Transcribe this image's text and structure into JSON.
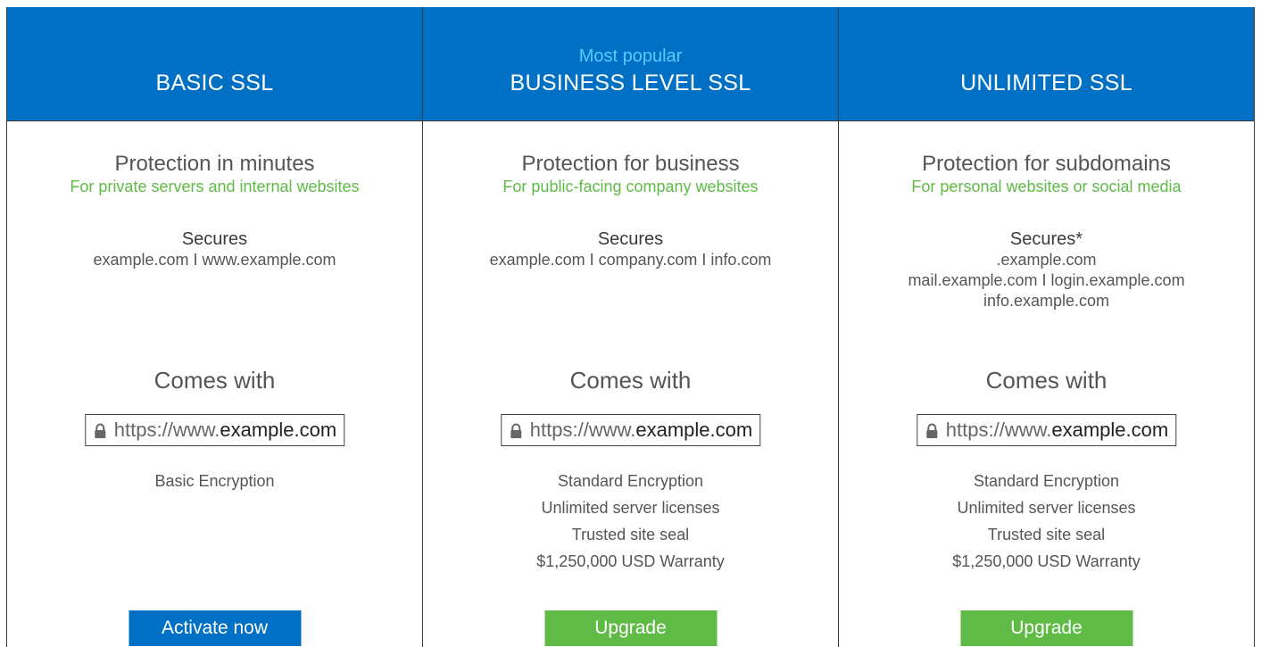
{
  "colors": {
    "header_bg": "#0070c4",
    "badge": "#5cc8ff",
    "accent_green": "#5fba46",
    "button_blue": "#0070c4",
    "button_green": "#5fba46"
  },
  "plans": [
    {
      "badge": "",
      "name": "BASIC SSL",
      "tagline": "Protection in minutes",
      "audience": "For private servers and internal websites",
      "secures_title": "Secures",
      "domains": [
        "example.com I www.example.com"
      ],
      "comes_with": "Comes with",
      "url_protocol": "https://www.",
      "url_domain": "example.com",
      "features": [
        "Basic Encryption"
      ],
      "cta": "Activate now",
      "cta_icon": "lock-icon"
    },
    {
      "badge": "Most popular",
      "name": "BUSINESS LEVEL SSL",
      "tagline": "Protection for business",
      "audience": "For public-facing company websites",
      "secures_title": "Secures",
      "domains": [
        "example.com I company.com I info.com"
      ],
      "comes_with": "Comes with",
      "url_protocol": "https://www.",
      "url_domain": "example.com",
      "features": [
        "Standard Encryption",
        "Unlimited server licenses",
        "Trusted site seal",
        "$1,250,000 USD Warranty"
      ],
      "cta": "Upgrade",
      "cta_icon": "lock-icon"
    },
    {
      "badge": "",
      "name": "UNLIMITED SSL",
      "tagline": "Protection for subdomains",
      "audience": "For personal websites or social media",
      "secures_title": "Secures*",
      "domains": [
        ".example.com",
        "mail.example.com I login.example.com",
        "info.example.com"
      ],
      "comes_with": "Comes with",
      "url_protocol": "https://www.",
      "url_domain": "example.com",
      "features": [
        "Standard Encryption",
        "Unlimited server licenses",
        "Trusted site seal",
        "$1,250,000 USD Warranty"
      ],
      "cta": "Upgrade",
      "cta_icon": "lock-icon"
    }
  ]
}
